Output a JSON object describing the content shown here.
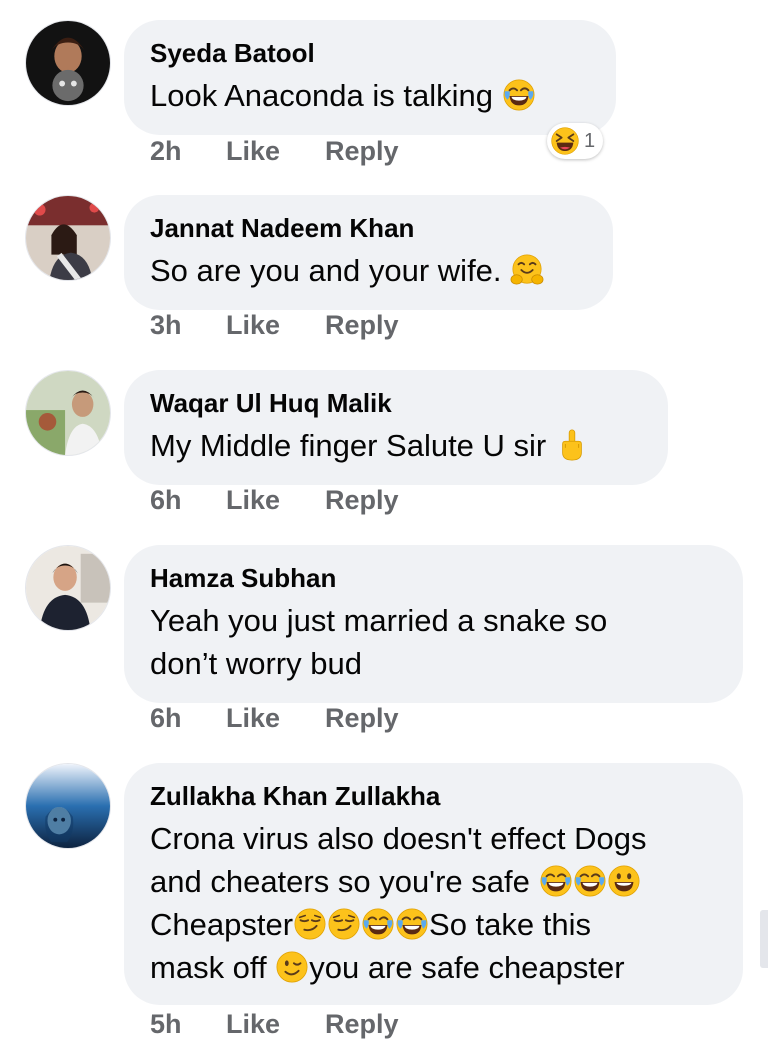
{
  "comments": [
    {
      "author": "Syeda Batool",
      "lines": [
        "Look Anaconda is talking"
      ],
      "time": "2h",
      "like": "Like",
      "reply": "Reply",
      "reaction_count": "1",
      "avatar_colors": [
        "#1b1b1b",
        "#6b3a2a"
      ]
    },
    {
      "author": "Jannat Nadeem Khan",
      "lines": [
        "So are you and your wife."
      ],
      "time": "3h",
      "like": "Like",
      "reply": "Reply",
      "avatar_colors": [
        "#c9b6a8",
        "#3a2a2a"
      ]
    },
    {
      "author": "Waqar Ul Huq Malik",
      "lines": [
        "My Middle finger Salute U sir"
      ],
      "time": "6h",
      "like": "Like",
      "reply": "Reply",
      "avatar_colors": [
        "#b6c98f",
        "#d8d8d8"
      ]
    },
    {
      "author": "Hamza Subhan",
      "lines": [
        "Yeah you just married a snake so",
        "don’t worry bud"
      ],
      "time": "6h",
      "like": "Like",
      "reply": "Reply",
      "avatar_colors": [
        "#e9e5df",
        "#1d2230"
      ]
    },
    {
      "author": "Zullakha Khan Zullakha",
      "lines": [
        "Crona virus also doesn't effect Dogs",
        "and cheaters so you're safe",
        "Cheapster",
        "So take this",
        "mask off",
        "you are safe cheapster"
      ],
      "time": "5h",
      "like": "Like",
      "reply": "Reply",
      "avatar_colors": [
        "#2a6fb0",
        "#0d2340"
      ]
    }
  ],
  "emoji_icons": [
    "tears-of-joy-emoji",
    "grinning-squinting-emoji",
    "hugging-face-emoji",
    "middle-finger-emoji",
    "grinning-emoji",
    "smirking-emoji",
    "winking-emoji"
  ],
  "colors": {
    "bubble": "#f0f2f5",
    "secondary_text": "#65676b",
    "emoji_yellow": "#fcc21b"
  }
}
